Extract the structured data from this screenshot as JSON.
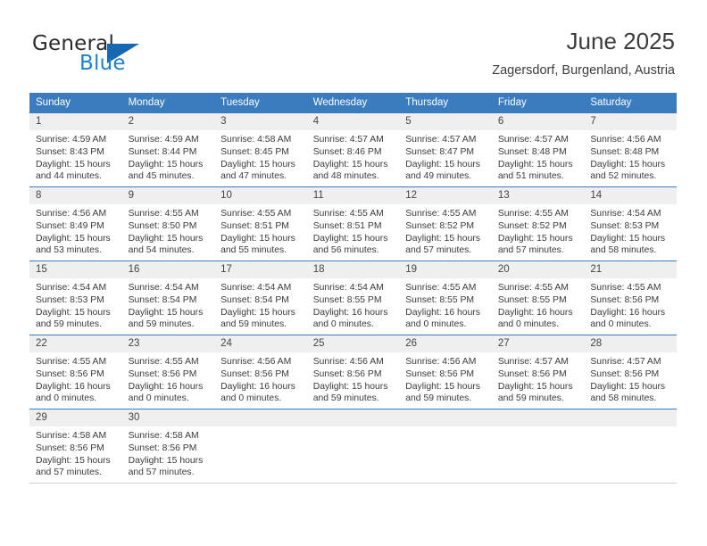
{
  "brand": {
    "name_part1": "General",
    "name_part2": "Blue"
  },
  "header": {
    "title": "June 2025",
    "subtitle": "Zagersdorf, Burgenland, Austria"
  },
  "theme": {
    "header_blue": "#3a7cbe",
    "logo_blue": "#1b7fd4",
    "daynum_band": "#efefef",
    "text": "#3b3b3b"
  },
  "weekdays": [
    "Sunday",
    "Monday",
    "Tuesday",
    "Wednesday",
    "Thursday",
    "Friday",
    "Saturday"
  ],
  "weeks": [
    [
      {
        "day": "1",
        "sunrise": "Sunrise: 4:59 AM",
        "sunset": "Sunset: 8:43 PM",
        "daylight1": "Daylight: 15 hours",
        "daylight2": "and 44 minutes."
      },
      {
        "day": "2",
        "sunrise": "Sunrise: 4:59 AM",
        "sunset": "Sunset: 8:44 PM",
        "daylight1": "Daylight: 15 hours",
        "daylight2": "and 45 minutes."
      },
      {
        "day": "3",
        "sunrise": "Sunrise: 4:58 AM",
        "sunset": "Sunset: 8:45 PM",
        "daylight1": "Daylight: 15 hours",
        "daylight2": "and 47 minutes."
      },
      {
        "day": "4",
        "sunrise": "Sunrise: 4:57 AM",
        "sunset": "Sunset: 8:46 PM",
        "daylight1": "Daylight: 15 hours",
        "daylight2": "and 48 minutes."
      },
      {
        "day": "5",
        "sunrise": "Sunrise: 4:57 AM",
        "sunset": "Sunset: 8:47 PM",
        "daylight1": "Daylight: 15 hours",
        "daylight2": "and 49 minutes."
      },
      {
        "day": "6",
        "sunrise": "Sunrise: 4:57 AM",
        "sunset": "Sunset: 8:48 PM",
        "daylight1": "Daylight: 15 hours",
        "daylight2": "and 51 minutes."
      },
      {
        "day": "7",
        "sunrise": "Sunrise: 4:56 AM",
        "sunset": "Sunset: 8:48 PM",
        "daylight1": "Daylight: 15 hours",
        "daylight2": "and 52 minutes."
      }
    ],
    [
      {
        "day": "8",
        "sunrise": "Sunrise: 4:56 AM",
        "sunset": "Sunset: 8:49 PM",
        "daylight1": "Daylight: 15 hours",
        "daylight2": "and 53 minutes."
      },
      {
        "day": "9",
        "sunrise": "Sunrise: 4:55 AM",
        "sunset": "Sunset: 8:50 PM",
        "daylight1": "Daylight: 15 hours",
        "daylight2": "and 54 minutes."
      },
      {
        "day": "10",
        "sunrise": "Sunrise: 4:55 AM",
        "sunset": "Sunset: 8:51 PM",
        "daylight1": "Daylight: 15 hours",
        "daylight2": "and 55 minutes."
      },
      {
        "day": "11",
        "sunrise": "Sunrise: 4:55 AM",
        "sunset": "Sunset: 8:51 PM",
        "daylight1": "Daylight: 15 hours",
        "daylight2": "and 56 minutes."
      },
      {
        "day": "12",
        "sunrise": "Sunrise: 4:55 AM",
        "sunset": "Sunset: 8:52 PM",
        "daylight1": "Daylight: 15 hours",
        "daylight2": "and 57 minutes."
      },
      {
        "day": "13",
        "sunrise": "Sunrise: 4:55 AM",
        "sunset": "Sunset: 8:52 PM",
        "daylight1": "Daylight: 15 hours",
        "daylight2": "and 57 minutes."
      },
      {
        "day": "14",
        "sunrise": "Sunrise: 4:54 AM",
        "sunset": "Sunset: 8:53 PM",
        "daylight1": "Daylight: 15 hours",
        "daylight2": "and 58 minutes."
      }
    ],
    [
      {
        "day": "15",
        "sunrise": "Sunrise: 4:54 AM",
        "sunset": "Sunset: 8:53 PM",
        "daylight1": "Daylight: 15 hours",
        "daylight2": "and 59 minutes."
      },
      {
        "day": "16",
        "sunrise": "Sunrise: 4:54 AM",
        "sunset": "Sunset: 8:54 PM",
        "daylight1": "Daylight: 15 hours",
        "daylight2": "and 59 minutes."
      },
      {
        "day": "17",
        "sunrise": "Sunrise: 4:54 AM",
        "sunset": "Sunset: 8:54 PM",
        "daylight1": "Daylight: 15 hours",
        "daylight2": "and 59 minutes."
      },
      {
        "day": "18",
        "sunrise": "Sunrise: 4:54 AM",
        "sunset": "Sunset: 8:55 PM",
        "daylight1": "Daylight: 16 hours",
        "daylight2": "and 0 minutes."
      },
      {
        "day": "19",
        "sunrise": "Sunrise: 4:55 AM",
        "sunset": "Sunset: 8:55 PM",
        "daylight1": "Daylight: 16 hours",
        "daylight2": "and 0 minutes."
      },
      {
        "day": "20",
        "sunrise": "Sunrise: 4:55 AM",
        "sunset": "Sunset: 8:55 PM",
        "daylight1": "Daylight: 16 hours",
        "daylight2": "and 0 minutes."
      },
      {
        "day": "21",
        "sunrise": "Sunrise: 4:55 AM",
        "sunset": "Sunset: 8:56 PM",
        "daylight1": "Daylight: 16 hours",
        "daylight2": "and 0 minutes."
      }
    ],
    [
      {
        "day": "22",
        "sunrise": "Sunrise: 4:55 AM",
        "sunset": "Sunset: 8:56 PM",
        "daylight1": "Daylight: 16 hours",
        "daylight2": "and 0 minutes."
      },
      {
        "day": "23",
        "sunrise": "Sunrise: 4:55 AM",
        "sunset": "Sunset: 8:56 PM",
        "daylight1": "Daylight: 16 hours",
        "daylight2": "and 0 minutes."
      },
      {
        "day": "24",
        "sunrise": "Sunrise: 4:56 AM",
        "sunset": "Sunset: 8:56 PM",
        "daylight1": "Daylight: 16 hours",
        "daylight2": "and 0 minutes."
      },
      {
        "day": "25",
        "sunrise": "Sunrise: 4:56 AM",
        "sunset": "Sunset: 8:56 PM",
        "daylight1": "Daylight: 15 hours",
        "daylight2": "and 59 minutes."
      },
      {
        "day": "26",
        "sunrise": "Sunrise: 4:56 AM",
        "sunset": "Sunset: 8:56 PM",
        "daylight1": "Daylight: 15 hours",
        "daylight2": "and 59 minutes."
      },
      {
        "day": "27",
        "sunrise": "Sunrise: 4:57 AM",
        "sunset": "Sunset: 8:56 PM",
        "daylight1": "Daylight: 15 hours",
        "daylight2": "and 59 minutes."
      },
      {
        "day": "28",
        "sunrise": "Sunrise: 4:57 AM",
        "sunset": "Sunset: 8:56 PM",
        "daylight1": "Daylight: 15 hours",
        "daylight2": "and 58 minutes."
      }
    ],
    [
      {
        "day": "29",
        "sunrise": "Sunrise: 4:58 AM",
        "sunset": "Sunset: 8:56 PM",
        "daylight1": "Daylight: 15 hours",
        "daylight2": "and 57 minutes."
      },
      {
        "day": "30",
        "sunrise": "Sunrise: 4:58 AM",
        "sunset": "Sunset: 8:56 PM",
        "daylight1": "Daylight: 15 hours",
        "daylight2": "and 57 minutes."
      },
      {
        "day": "",
        "sunrise": "",
        "sunset": "",
        "daylight1": "",
        "daylight2": ""
      },
      {
        "day": "",
        "sunrise": "",
        "sunset": "",
        "daylight1": "",
        "daylight2": ""
      },
      {
        "day": "",
        "sunrise": "",
        "sunset": "",
        "daylight1": "",
        "daylight2": ""
      },
      {
        "day": "",
        "sunrise": "",
        "sunset": "",
        "daylight1": "",
        "daylight2": ""
      },
      {
        "day": "",
        "sunrise": "",
        "sunset": "",
        "daylight1": "",
        "daylight2": ""
      }
    ]
  ]
}
